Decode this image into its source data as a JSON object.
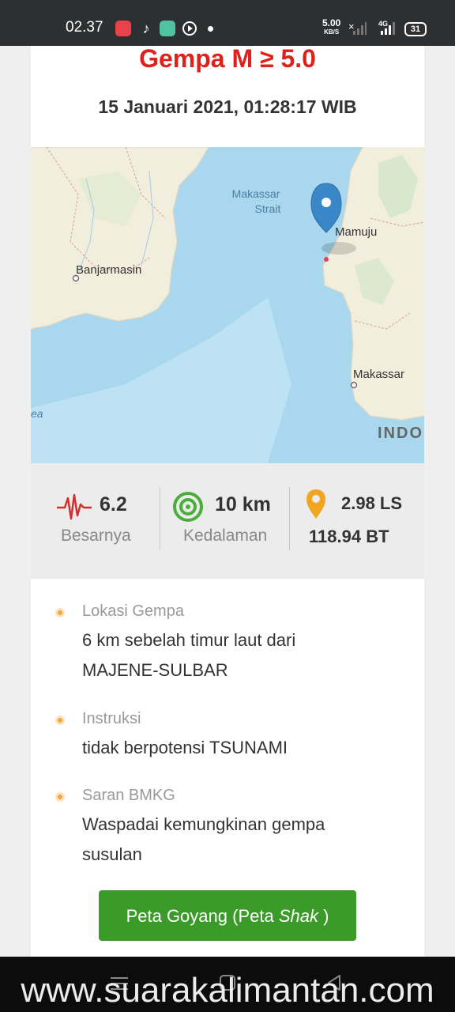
{
  "status_bar": {
    "time": "02.37",
    "net_speed": "5.00",
    "net_unit": "KB/S",
    "network": "4G",
    "battery": "31"
  },
  "page": {
    "title": "Gempa M ≥ 5.0",
    "date": "15 Januari 2021, 01:28:17 WIB"
  },
  "map": {
    "labels": [
      "Makassar",
      "Strait",
      "Mamuju",
      "Banjarmasin",
      "Makassar",
      "INDO",
      "ea"
    ]
  },
  "stats": {
    "magnitude": "6.2",
    "magnitude_label": "Besarnya",
    "depth": "10 km",
    "depth_label": "Kedalaman",
    "lat": "2.98 LS",
    "lon": "118.94 BT"
  },
  "info": {
    "location_label": "Lokasi Gempa",
    "location_line1": "6 km sebelah timur laut dari",
    "location_line2": "MAJENE-SULBAR",
    "instruction_label": "Instruksi",
    "instruction_value": "tidak berpotensi TSUNAMI",
    "advice_label": "Saran BMKG",
    "advice_line1": "Waspadai kemungkinan gempa",
    "advice_line2": "susulan"
  },
  "button": {
    "label": "Peta Goyang (Peta ",
    "label_italic": "Shak",
    "label_end": " )"
  },
  "watermark": "www.suarakalimantan.com",
  "colors": {
    "accent_red": "#e0201b",
    "button_green": "#3a9b28",
    "pin_blue": "#3a87c8",
    "sea": "#a9d7ee",
    "land": "#f2eedd"
  }
}
